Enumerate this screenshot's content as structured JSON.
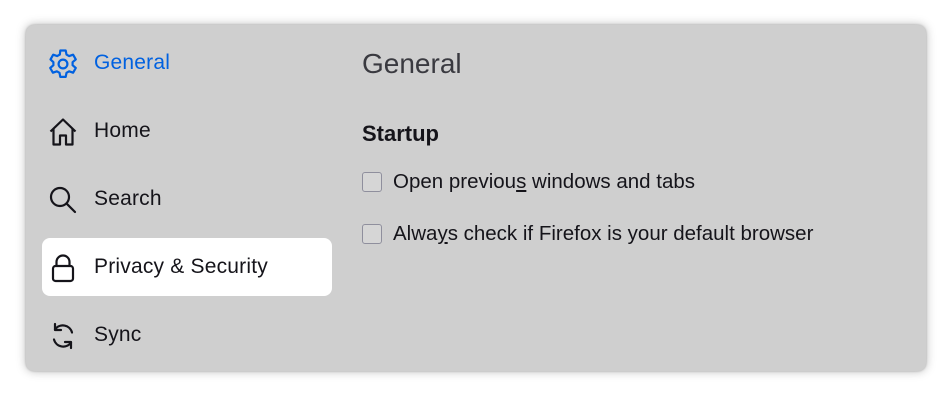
{
  "sidebar": {
    "items": [
      {
        "label": "General",
        "icon": "gear-icon",
        "state": "selected"
      },
      {
        "label": "Home",
        "icon": "home-icon",
        "state": "normal"
      },
      {
        "label": "Search",
        "icon": "search-icon",
        "state": "normal"
      },
      {
        "label": "Privacy & Security",
        "icon": "lock-icon",
        "state": "highlighted"
      },
      {
        "label": "Sync",
        "icon": "sync-icon",
        "state": "normal"
      }
    ]
  },
  "main": {
    "title": "General",
    "section": {
      "title": "Startup",
      "options": [
        {
          "pre": "Open previou",
          "key": "s",
          "post": " windows and tabs",
          "checked": false
        },
        {
          "pre": "Alwa",
          "key": "y",
          "post": "s check if Firefox is your default browser",
          "checked": false
        }
      ]
    }
  },
  "colors": {
    "accent": "#0061e0",
    "background": "#cfcfcf",
    "highlight": "#ffffff",
    "text": "#15141a"
  }
}
